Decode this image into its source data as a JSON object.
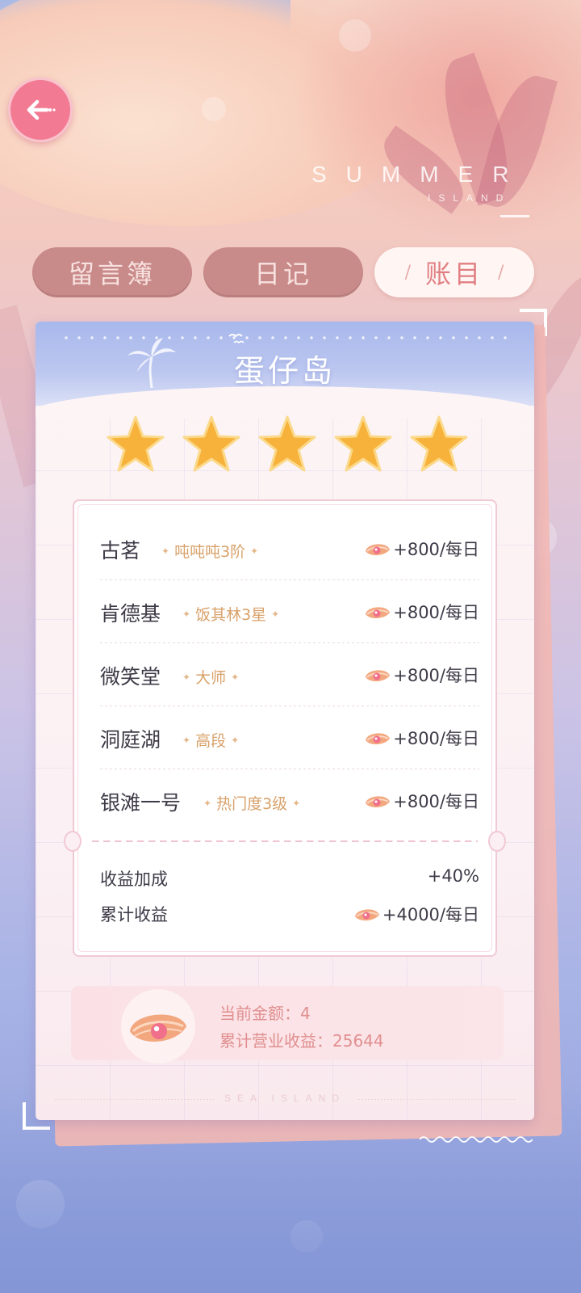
{
  "background": {
    "summer_text": "SUMMER",
    "island_text": "ISLAND"
  },
  "back_button": {
    "icon": "back-arrow-icon"
  },
  "tabs": [
    {
      "label": "留言簿",
      "active": false
    },
    {
      "label": "日记",
      "active": false
    },
    {
      "label": "账目",
      "active": true
    }
  ],
  "card": {
    "title": "蛋仔岛",
    "stars": {
      "filled": 5,
      "total": 5
    },
    "entries": [
      {
        "name": "古茗",
        "tag": "吨吨吨3阶",
        "income": "+800/每日"
      },
      {
        "name": "肯德基",
        "tag": "饭其林3星",
        "income": "+800/每日"
      },
      {
        "name": "微笑堂",
        "tag": "大师",
        "income": "+800/每日"
      },
      {
        "name": "洞庭湖",
        "tag": "高段",
        "income": "+800/每日"
      },
      {
        "name": "银滩一号",
        "tag": "热门度3级",
        "income": "+800/每日"
      }
    ],
    "bonus_label": "收益加成",
    "bonus_value": "+40%",
    "total_label": "累计收益",
    "total_value": "+4000/每日",
    "current_amount": "当前金额：4",
    "total_business_income": "累计营业收益：25644",
    "footer": "SEA ISLAND"
  },
  "colors": {
    "accent_pink": "#f27a93",
    "tag_gold": "#d8a16a",
    "balance_text": "#e08f8f",
    "star_gold": "#f7b23b"
  }
}
